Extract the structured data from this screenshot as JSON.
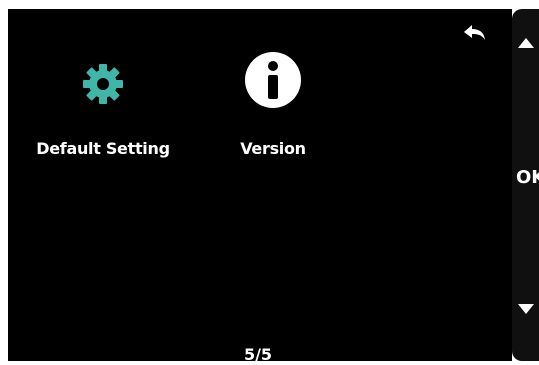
{
  "items": [
    {
      "label": "Default Setting",
      "icon": "gear-icon",
      "icon_color": "#3fb6a8"
    },
    {
      "label": "Version",
      "icon": "info-icon",
      "icon_color": "#ffffff"
    }
  ],
  "page_indicator": "5/5",
  "side_panel": {
    "ok_label": "OK",
    "up_icon": "arrow-up-icon",
    "down_icon": "arrow-down-icon"
  },
  "back_icon": "back-arrow-icon",
  "colors": {
    "screen_bg": "#000000",
    "text": "#ffffff",
    "accent": "#3fb6a8"
  }
}
